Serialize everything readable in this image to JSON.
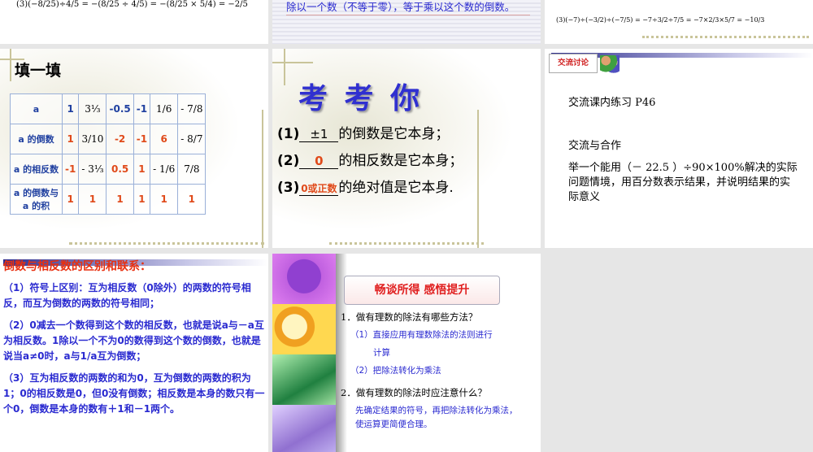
{
  "top_row": {
    "left_formula": "(3)(−8/25)÷4/5 = −(8/25 ÷ 4/5) = −(8/25 × 5/4) = −2/5",
    "middle_text": "除以一个数（不等于零），等于乘以这个数的倒数。",
    "right_formula": "(3)(−7)÷(−3/2)÷(−7/5) = −7÷3/2÷7/5 = −7×2/3×5/7 = −10/3"
  },
  "slide_fill": {
    "title": "填一填",
    "rows": [
      {
        "header": "a",
        "cells": [
          "1",
          "3⅓",
          "-0.5",
          "-1",
          "1/6",
          "- 7/8"
        ]
      },
      {
        "header": "a 的倒数",
        "cells": [
          "1",
          "3/10",
          "-2",
          "-1",
          "6",
          "- 8/7"
        ]
      },
      {
        "header": "a 的相反数",
        "cells": [
          "-1",
          "- 3⅓",
          "0.5",
          "1",
          "- 1/6",
          "7/8"
        ]
      },
      {
        "header": "a 的倒数与 a 的积",
        "cells": [
          "1",
          "1",
          "1",
          "1",
          "1",
          "1"
        ]
      }
    ]
  },
  "slide_quiz": {
    "title": "考 考 你",
    "items": [
      {
        "num": "(1)",
        "answer": "±1",
        "text": "的倒数是它本身；"
      },
      {
        "num": "(2)",
        "answer": "0",
        "text": "的相反数是它本身；"
      },
      {
        "num": "(3)",
        "answer": "0或正数",
        "text": "的绝对值是它本身."
      }
    ]
  },
  "slide_discuss": {
    "badge": "交流讨论",
    "line1": "交流课内练习 P46",
    "line2": "交流与合作",
    "line3": "举一个能用（－ 22.5 ）÷90×100%解决的实际问题情境，用百分数表示结果，并说明结果的实际意义"
  },
  "slide_diff": {
    "title": "倒数与相反数的区别和联系：",
    "p1": "（1）符号上区别：互为相反数（0除外）的两数的符号相反，而互为倒数的两数的符号相同；",
    "p2": "（2）0减去一个数得到这个数的相反数，也就是说a与－a互为相反数。1除以一个不为0的数得到这个数的倒数，也就是说当a≠0时，a与1/a互为倒数；",
    "p3": "（3）互为相反数的两数的和为0，互为倒数的两数的积为1；0的相反数是0，但0没有倒数；相反数是本身的数只有一个0，倒数是本身的数有＋1和－1两个。"
  },
  "slide_summary": {
    "banner": "畅谈所得 感悟提升",
    "q1": "1．做有理数的除法有哪些方法？",
    "a1a": "（1）直接应用有理数除法的法则进行",
    "a1b": "计算",
    "a1c": "（2）把除法转化为乘法",
    "q2": "2．做有理数的除法时应注意什么？",
    "a2": "先确定结果的符号，再把除法转化为乘法，使运算更简便合理。"
  }
}
